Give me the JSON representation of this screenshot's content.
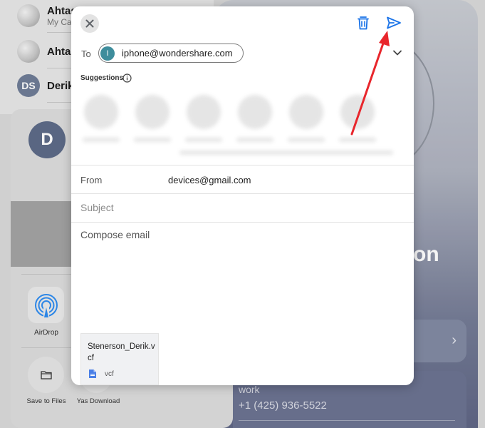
{
  "background": {
    "contacts": [
      {
        "name": "Ahtas",
        "subtitle": "My Ca"
      },
      {
        "name": "Ahtas",
        "subtitle": ""
      },
      {
        "name": "Derik",
        "initials": "DS"
      }
    ],
    "share_sheet": {
      "avatar_initial": "D",
      "airdrop_label": "AirDrop",
      "save_files_label": "Save to Files",
      "yas_label": "Yas Download"
    },
    "contact_card": {
      "name_fragment": "on",
      "work_label": "work",
      "work_phone": "+1 (425) 936-5522"
    }
  },
  "compose": {
    "to_label": "To",
    "recipient": {
      "initial": "I",
      "email": "iphone@wondershare.com"
    },
    "suggestions_label": "Suggestions",
    "from_label": "From",
    "from_value": "devices@gmail.com",
    "subject_placeholder": "Subject",
    "body_placeholder": "Compose email",
    "attachment": {
      "name": "Stenerson_Derik.vcf",
      "type": "vcf"
    }
  },
  "colors": {
    "accent": "#1a73e8",
    "annotation_arrow": "#e8262c",
    "chip_avatar": "#3e8d9c"
  }
}
